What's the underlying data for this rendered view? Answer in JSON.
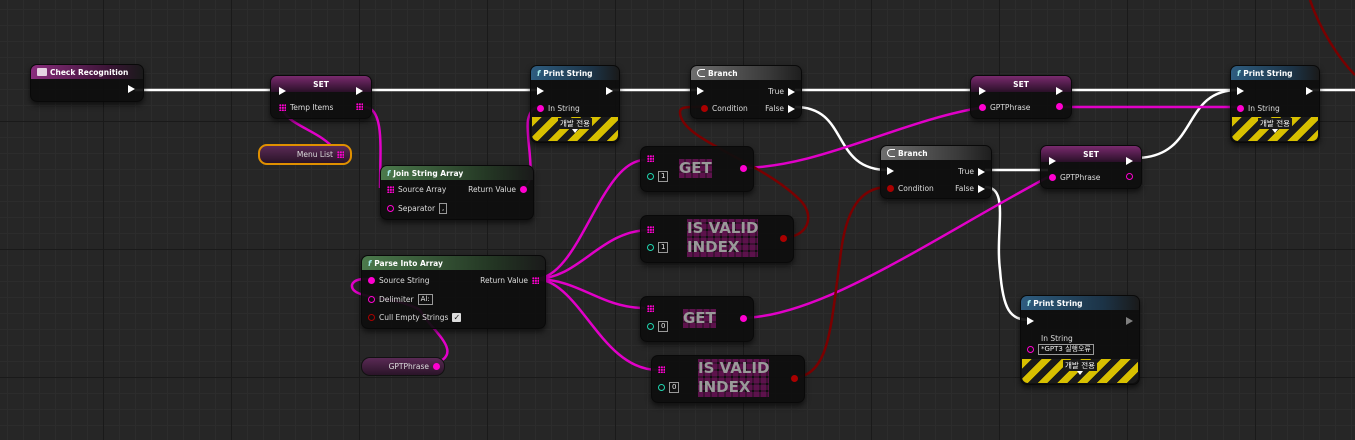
{
  "nodes": {
    "event": {
      "title": "Check Recognition"
    },
    "set1": {
      "title": "SET",
      "pin": "Temp Items"
    },
    "menu_list": {
      "label": "Menu List"
    },
    "join": {
      "title": "Join String Array",
      "in1": "Source Array",
      "in2": "Separator",
      "out": "Return Value",
      "sep_value": ","
    },
    "print1": {
      "title": "Print String",
      "pin": "In String",
      "dev_label": "개발 전용"
    },
    "branch1": {
      "title": "Branch",
      "cond": "Condition",
      "true": "True",
      "false": "False"
    },
    "get1": {
      "title": "GET",
      "index": "1"
    },
    "valid1": {
      "title_line1": "IS VALID",
      "title_line2": "INDEX",
      "index": "1"
    },
    "parse": {
      "title": "Parse Into Array",
      "in1": "Source String",
      "in2": "Delimiter",
      "in3": "Cull Empty Strings",
      "out": "Return Value",
      "delim_value": "Al:"
    },
    "gptphrase_var": {
      "label": "GPTPhrase"
    },
    "get0": {
      "title": "GET",
      "index": "0"
    },
    "valid0": {
      "title_line1": "IS VALID",
      "title_line2": "INDEX",
      "index": "0"
    },
    "branch2": {
      "title": "Branch",
      "cond": "Condition",
      "true": "True",
      "false": "False"
    },
    "set2": {
      "title": "SET",
      "pin": "GPTPhrase"
    },
    "set3": {
      "title": "SET",
      "pin": "GPTPhrase"
    },
    "print2": {
      "title": "Print String",
      "pin": "In String",
      "dev_label": "개발 전용"
    },
    "print3": {
      "title": "Print String",
      "pin": "In String",
      "string_value": "*GPT3 실행오류",
      "dev_label": "개발 전용"
    }
  },
  "colors": {
    "exec": "#ffffff",
    "string": "#ff00d0",
    "bool": "#a00000",
    "int": "#1fd6b0"
  }
}
